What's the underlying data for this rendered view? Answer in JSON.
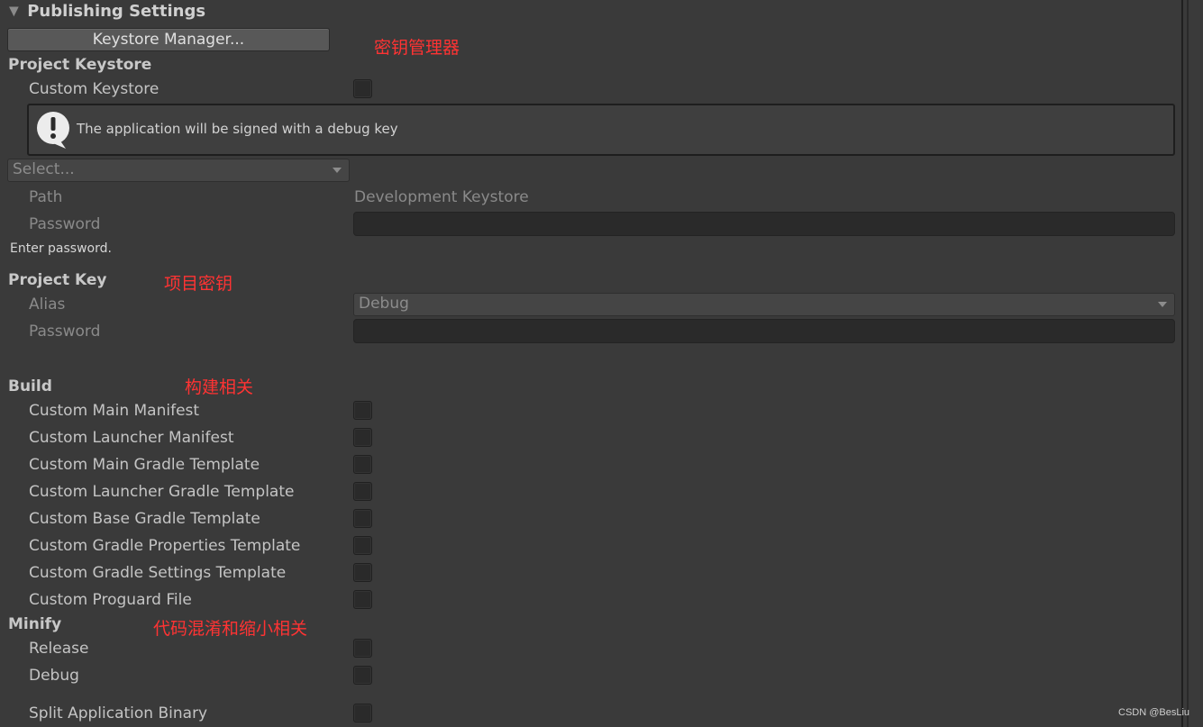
{
  "foldout": {
    "arrow": "▼",
    "title": "Publishing Settings"
  },
  "keystore_manager_button": "Keystore Manager...",
  "annotations": {
    "keystore_manager": "密钥管理器",
    "project_key": "项目密钥",
    "build": "构建相关",
    "minify": "代码混淆和缩小相关"
  },
  "project_keystore": {
    "heading": "Project Keystore",
    "custom_keystore_label": "Custom Keystore",
    "custom_keystore_checked": false,
    "info_icon": "exclamation-icon",
    "info_message": "The application will be signed with a debug key",
    "select_value": "Select...",
    "path_label": "Path",
    "path_value": "Development Keystore",
    "password_label": "Password",
    "password_value": "",
    "password_hint": "Enter password."
  },
  "project_key": {
    "heading": "Project Key",
    "alias_label": "Alias",
    "alias_value": "Debug",
    "password_label": "Password",
    "password_value": ""
  },
  "build": {
    "heading": "Build",
    "items": [
      {
        "label": "Custom Main Manifest",
        "checked": false
      },
      {
        "label": "Custom Launcher Manifest",
        "checked": false
      },
      {
        "label": "Custom Main Gradle Template",
        "checked": false
      },
      {
        "label": "Custom Launcher Gradle Template",
        "checked": false
      },
      {
        "label": "Custom Base Gradle Template",
        "checked": false
      },
      {
        "label": "Custom Gradle Properties Template",
        "checked": false
      },
      {
        "label": "Custom Gradle Settings Template",
        "checked": false
      },
      {
        "label": "Custom Proguard File",
        "checked": false
      }
    ]
  },
  "minify": {
    "heading": "Minify",
    "items": [
      {
        "label": "Release",
        "checked": false
      },
      {
        "label": "Debug",
        "checked": false
      }
    ]
  },
  "split_binary": {
    "label": "Split Application Binary",
    "checked": false
  },
  "watermark": "CSDN @BesLiu",
  "colors": {
    "background": "#3a3a3a",
    "annotation": "#ff3333",
    "field_bg": "#2a2a2a",
    "button_bg": "#585858"
  }
}
